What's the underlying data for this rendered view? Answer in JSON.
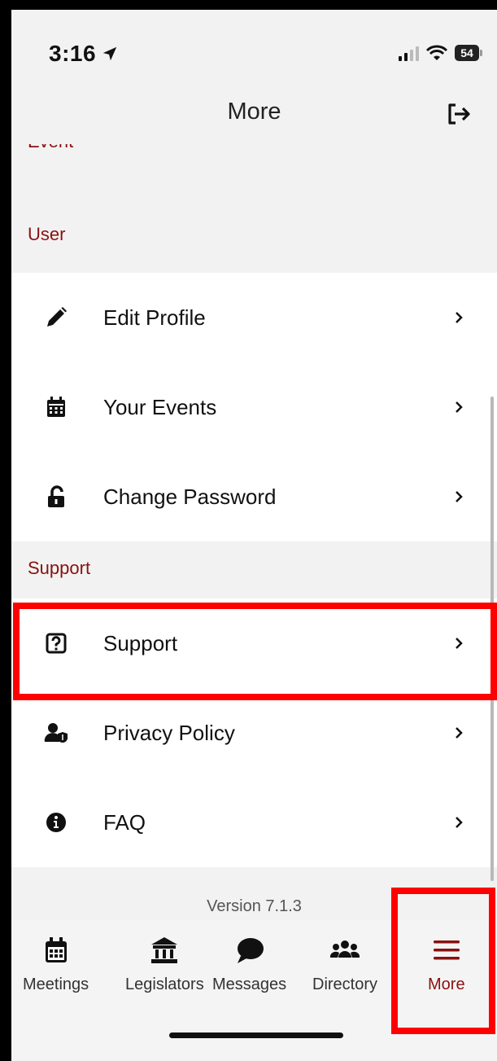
{
  "status_bar": {
    "time": "3:16",
    "battery": "54"
  },
  "header": {
    "title": "More"
  },
  "partial_heading": "Event",
  "sections": [
    {
      "title": "User",
      "items": [
        {
          "label": "Edit Profile",
          "icon": "pencil-icon"
        },
        {
          "label": "Your Events",
          "icon": "calendar-icon"
        },
        {
          "label": "Change Password",
          "icon": "unlock-icon"
        }
      ]
    },
    {
      "title": "Support",
      "items": [
        {
          "label": "Support",
          "icon": "question-box-icon"
        },
        {
          "label": "Privacy Policy",
          "icon": "user-shield-icon"
        },
        {
          "label": "FAQ",
          "icon": "info-circle-icon"
        }
      ]
    }
  ],
  "version": "Version 7.1.3",
  "tabs": [
    {
      "label": "Meetings",
      "icon": "calendar-icon"
    },
    {
      "label": "Legislators",
      "icon": "landmark-icon"
    },
    {
      "label": "Messages",
      "icon": "chat-bubble-icon"
    },
    {
      "label": "Directory",
      "icon": "users-icon"
    },
    {
      "label": "More",
      "icon": "hamburger-icon",
      "active": true
    }
  ],
  "colors": {
    "accent": "#8b1010",
    "highlight": "#ff0000",
    "background": "#f2f2f2",
    "row": "#ffffff"
  }
}
